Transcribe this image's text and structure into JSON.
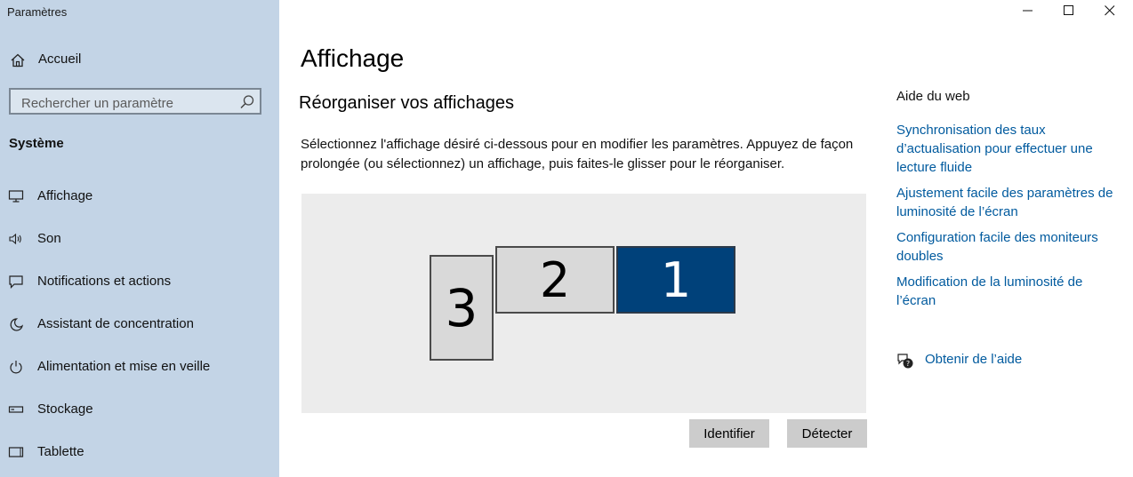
{
  "app": {
    "title": "Paramètres"
  },
  "sidebar": {
    "home_label": "Accueil",
    "search_placeholder": "Rechercher un paramètre",
    "section_title": "Système",
    "items": [
      {
        "label": "Affichage",
        "icon": "monitor-icon"
      },
      {
        "label": "Son",
        "icon": "speaker-icon"
      },
      {
        "label": "Notifications et actions",
        "icon": "notification-icon"
      },
      {
        "label": "Assistant de concentration",
        "icon": "moon-icon"
      },
      {
        "label": "Alimentation et mise en veille",
        "icon": "power-icon"
      },
      {
        "label": "Stockage",
        "icon": "storage-icon"
      },
      {
        "label": "Tablette",
        "icon": "tablet-icon"
      }
    ]
  },
  "main": {
    "title": "Affichage",
    "subtitle": "Réorganiser vos affichages",
    "description": "Sélectionnez l'affichage désiré ci-dessous pour en modifier les paramètres. Appuyez de façon prolongée (ou sélectionnez) un affichage, puis faites-le glisser pour le réorganiser.",
    "monitors": [
      {
        "number": "3",
        "selected": false
      },
      {
        "number": "2",
        "selected": false
      },
      {
        "number": "1",
        "selected": true
      }
    ],
    "identify_label": "Identifier",
    "detect_label": "Détecter"
  },
  "help": {
    "title": "Aide du web",
    "links": [
      "Synchronisation des taux d’actualisation pour effectuer une lecture fluide",
      "Ajustement facile des paramètres de luminosité de l’écran",
      "Configuration facile des moniteurs doubles",
      "Modification de la luminosité de l’écran"
    ],
    "get_help_label": "Obtenir de l’aide"
  },
  "colors": {
    "sidebar_bg": "#c3d4e6",
    "accent": "#00417a",
    "link": "#005a9e"
  }
}
